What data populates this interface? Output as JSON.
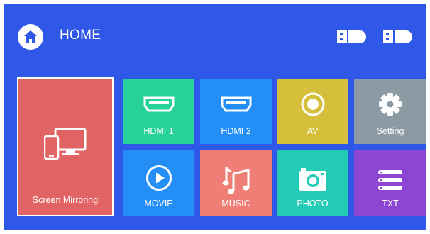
{
  "header": {
    "title": "HOME",
    "home_icon": "home-icon",
    "usb_icons": [
      "usb-drive-icon",
      "usb-drive-icon"
    ]
  },
  "tiles": [
    {
      "label": "Screen Mirroring",
      "icon": "screen-mirroring-icon",
      "color": "#e26363"
    },
    {
      "label": "HDMI 1",
      "icon": "hdmi-icon",
      "color": "#27d19a"
    },
    {
      "label": "HDMI 2",
      "icon": "hdmi-icon",
      "color": "#238ef5"
    },
    {
      "label": "AV",
      "icon": "av-icon",
      "color": "#d6bf3b"
    },
    {
      "label": "Setting",
      "icon": "gear-icon",
      "color": "#8c9ba3"
    },
    {
      "label": "MOVIE",
      "icon": "play-icon",
      "color": "#238ef5"
    },
    {
      "label": "MUSIC",
      "icon": "music-icon",
      "color": "#ef7f76"
    },
    {
      "label": "PHOTO",
      "icon": "camera-icon",
      "color": "#23cbb6"
    },
    {
      "label": "TXT",
      "icon": "text-lines-icon",
      "color": "#8c46d1"
    }
  ],
  "colors": {
    "background": "#2f57e8",
    "text": "#ffffff"
  }
}
